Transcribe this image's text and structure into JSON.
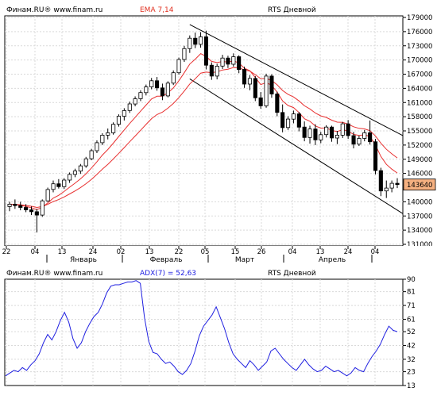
{
  "price_panel": {
    "source": "Финам.RU® www.finam.ru",
    "indicator": "EMA 7,14",
    "title": "RTS Дневной",
    "last_price_label": "143640"
  },
  "adx_panel": {
    "source": "Финам.RU® www.finam.ru",
    "indicator": "ADX(7) = 52,63",
    "title": "RTS Дневной"
  },
  "colors": {
    "candle_up": "#ffffff",
    "candle_down": "#000000",
    "ema": "#e83030",
    "adx_line": "#1f1fe0",
    "indicator_label": "#e03020",
    "adx_label": "#1a1ae0",
    "price_tag": "#f5b080",
    "plot_bg": "#ffffff",
    "grid": "#d9d9d9"
  },
  "chart_data": [
    {
      "type": "candlestick",
      "title": "RTS Дневной",
      "y_ticks": [
        "179000",
        "176000",
        "173000",
        "170000",
        "167000",
        "164000",
        "161000",
        "158000",
        "155000",
        "152000",
        "149000",
        "146000",
        "143640",
        "140000",
        "137000",
        "134000",
        "131000"
      ],
      "ylim": [
        131000,
        179000
      ],
      "x_ticks": [
        "22",
        "04",
        "13",
        "24",
        "02",
        "13",
        "22",
        "05",
        "15",
        "26",
        "04",
        "13",
        "24",
        "04"
      ],
      "month_labels": [
        "Январь",
        "Февраль",
        "Март",
        "Апрель"
      ],
      "series": [
        {
          "name": "EMA 7",
          "type": "line"
        },
        {
          "name": "EMA 14",
          "type": "line"
        }
      ],
      "candles": [
        [
          139000,
          140000,
          138000,
          139500
        ],
        [
          139500,
          140500,
          138500,
          139200
        ],
        [
          139200,
          140000,
          138200,
          138800
        ],
        [
          138800,
          139500,
          137800,
          138300
        ],
        [
          138300,
          139000,
          137200,
          137900
        ],
        [
          137900,
          138500,
          133500,
          137200
        ],
        [
          137200,
          140500,
          136800,
          140200
        ],
        [
          140200,
          143000,
          140000,
          142600
        ],
        [
          142600,
          144500,
          142000,
          143800
        ],
        [
          143800,
          144800,
          142800,
          143200
        ],
        [
          143200,
          145000,
          142700,
          144600
        ],
        [
          144600,
          146200,
          144000,
          145800
        ],
        [
          145800,
          147000,
          145200,
          146500
        ],
        [
          146500,
          148000,
          145900,
          147600
        ],
        [
          147600,
          149500,
          147200,
          149100
        ],
        [
          149100,
          151200,
          148800,
          150800
        ],
        [
          150800,
          153000,
          150300,
          152500
        ],
        [
          152500,
          154500,
          152000,
          154100
        ],
        [
          154100,
          155500,
          153200,
          154600
        ],
        [
          154600,
          156800,
          154200,
          156400
        ],
        [
          156400,
          158500,
          155900,
          158100
        ],
        [
          158100,
          159800,
          157200,
          159300
        ],
        [
          159300,
          161200,
          158800,
          160700
        ],
        [
          160700,
          162300,
          160200,
          161800
        ],
        [
          161800,
          163600,
          161300,
          163100
        ],
        [
          163100,
          164800,
          162500,
          164300
        ],
        [
          164300,
          166200,
          163800,
          165600
        ],
        [
          165600,
          166400,
          163500,
          164100
        ],
        [
          164100,
          165000,
          161500,
          162400
        ],
        [
          162400,
          165500,
          162100,
          165100
        ],
        [
          165100,
          167800,
          164700,
          167300
        ],
        [
          167300,
          170500,
          166900,
          170100
        ],
        [
          170100,
          173000,
          169600,
          172400
        ],
        [
          172400,
          175200,
          171500,
          174600
        ],
        [
          174600,
          175800,
          172500,
          173300
        ],
        [
          173300,
          175900,
          172600,
          174900
        ],
        [
          174900,
          176200,
          168000,
          168900
        ],
        [
          168900,
          169500,
          165800,
          166600
        ],
        [
          166600,
          169200,
          165900,
          168700
        ],
        [
          168700,
          171100,
          168100,
          170400
        ],
        [
          170400,
          170900,
          168300,
          169100
        ],
        [
          169100,
          171400,
          168600,
          170700
        ],
        [
          170700,
          171000,
          167200,
          168000
        ],
        [
          168000,
          168600,
          164100,
          164900
        ],
        [
          164900,
          166800,
          163600,
          166100
        ],
        [
          166100,
          166600,
          161300,
          162000
        ],
        [
          162000,
          163200,
          159700,
          160300
        ],
        [
          160300,
          167100,
          159900,
          166600
        ],
        [
          166600,
          167000,
          162000,
          162800
        ],
        [
          162800,
          163300,
          158100,
          158900
        ],
        [
          158900,
          160600,
          154700,
          155700
        ],
        [
          155700,
          158100,
          155200,
          157500
        ],
        [
          157500,
          159300,
          156600,
          158600
        ],
        [
          158600,
          159000,
          154900,
          155800
        ],
        [
          155800,
          157000,
          152800,
          153600
        ],
        [
          153600,
          156100,
          152300,
          155400
        ],
        [
          155400,
          156400,
          152000,
          153100
        ],
        [
          153100,
          154800,
          152400,
          154200
        ],
        [
          154200,
          156200,
          153600,
          155800
        ],
        [
          155800,
          156100,
          152700,
          153500
        ],
        [
          153500,
          155000,
          152200,
          154100
        ],
        [
          154100,
          156900,
          153500,
          156500
        ],
        [
          156500,
          157300,
          153300,
          154000
        ],
        [
          154000,
          154800,
          151300,
          152200
        ],
        [
          152200,
          154000,
          151800,
          153400
        ],
        [
          153400,
          155200,
          152800,
          154600
        ],
        [
          154600,
          157200,
          152100,
          152700
        ],
        [
          152700,
          153300,
          145800,
          146600
        ],
        [
          146600,
          147200,
          141200,
          142300
        ],
        [
          142300,
          144500,
          140800,
          142900
        ],
        [
          142900,
          144500,
          142000,
          143900
        ],
        [
          143900,
          145000,
          142900,
          143640
        ]
      ]
    },
    {
      "type": "line",
      "title": "RTS Дневной",
      "y_ticks": [
        "90",
        "81",
        "71",
        "61",
        "52",
        "42",
        "32",
        "23",
        "13"
      ],
      "ylim": [
        13,
        90
      ],
      "x_ticks": [
        "22",
        "04",
        "13",
        "24",
        "02",
        "13",
        "22",
        "05",
        "15",
        "26",
        "04",
        "13",
        "24",
        "04"
      ],
      "series": [
        {
          "name": "ADX(7)",
          "values": [
            20,
            22,
            24,
            23,
            26,
            24,
            28,
            31,
            36,
            44,
            50,
            46,
            52,
            60,
            66,
            59,
            47,
            40,
            44,
            52,
            58,
            63,
            66,
            72,
            80,
            85,
            86,
            86,
            87,
            88,
            88,
            89,
            87,
            62,
            45,
            37,
            36,
            32,
            29,
            30,
            27,
            23,
            21,
            24,
            29,
            38,
            49,
            56,
            60,
            64,
            70,
            62,
            54,
            44,
            36,
            32,
            29,
            26,
            31,
            28,
            24,
            27,
            30,
            38,
            40,
            36,
            32,
            29,
            26,
            24,
            28,
            32,
            28,
            25,
            23,
            24,
            27,
            25,
            23,
            24,
            22,
            20,
            22,
            26,
            24,
            23,
            29,
            34,
            38,
            43,
            50,
            56,
            53,
            52
          ]
        }
      ]
    }
  ]
}
